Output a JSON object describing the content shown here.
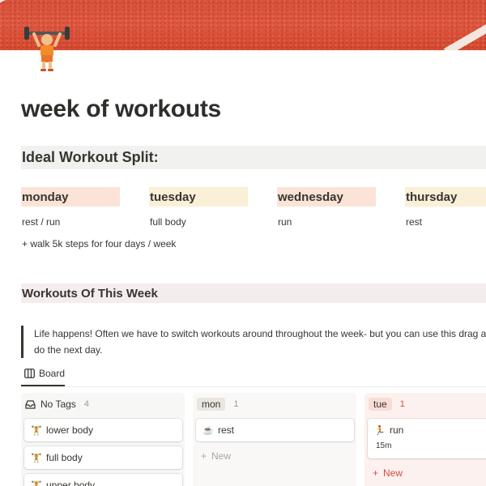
{
  "page": {
    "title": "week of workouts",
    "icon": "weightlifter-icon"
  },
  "split": {
    "heading": "Ideal Workout Split:",
    "days": [
      {
        "label": "monday",
        "value": "rest / run",
        "color": "#fbe4d7"
      },
      {
        "label": "tuesday",
        "value": "full body",
        "color": "#faefd7"
      },
      {
        "label": "wednesday",
        "value": "run",
        "color": "#fbe4d7"
      },
      {
        "label": "thursday",
        "value": "rest",
        "color": "#faefd7"
      }
    ],
    "note": "+ walk 5k steps for four days / week"
  },
  "week": {
    "heading": "Workouts Of This Week",
    "callout_line1": "Life happens! Often we have to switch workouts around throughout the week- but you can use this drag a",
    "callout_line2": "do the next day."
  },
  "view": {
    "icon": "board-icon",
    "label": "Board"
  },
  "board": {
    "columns": [
      {
        "name": "No Tags",
        "count": "4",
        "icon": "no-tag-icon",
        "bg": "#f7f7f5",
        "cards": [
          {
            "title": "lower body",
            "icon": "weightlifter-icon"
          },
          {
            "title": "full body",
            "icon": "weightlifter-icon"
          },
          {
            "title": "upper body",
            "icon": "weightlifter-icon"
          }
        ]
      },
      {
        "name": "mon",
        "count": "1",
        "bg": "#f9f8f6",
        "tag_color": "#e9e6e2",
        "cards": [
          {
            "title": "rest",
            "icon": "coffee-icon"
          }
        ],
        "new_label": "New",
        "new_color": "#a7a6a2"
      },
      {
        "name": "tue",
        "count": "1",
        "bg": "#fcf1ef",
        "tag_color": "#f9dcd6",
        "count_color": "#d44c47",
        "cards": [
          {
            "title": "run",
            "icon": "runner-icon",
            "detail": "15m"
          }
        ],
        "new_label": "New",
        "new_color": "#d44c47"
      }
    ]
  }
}
